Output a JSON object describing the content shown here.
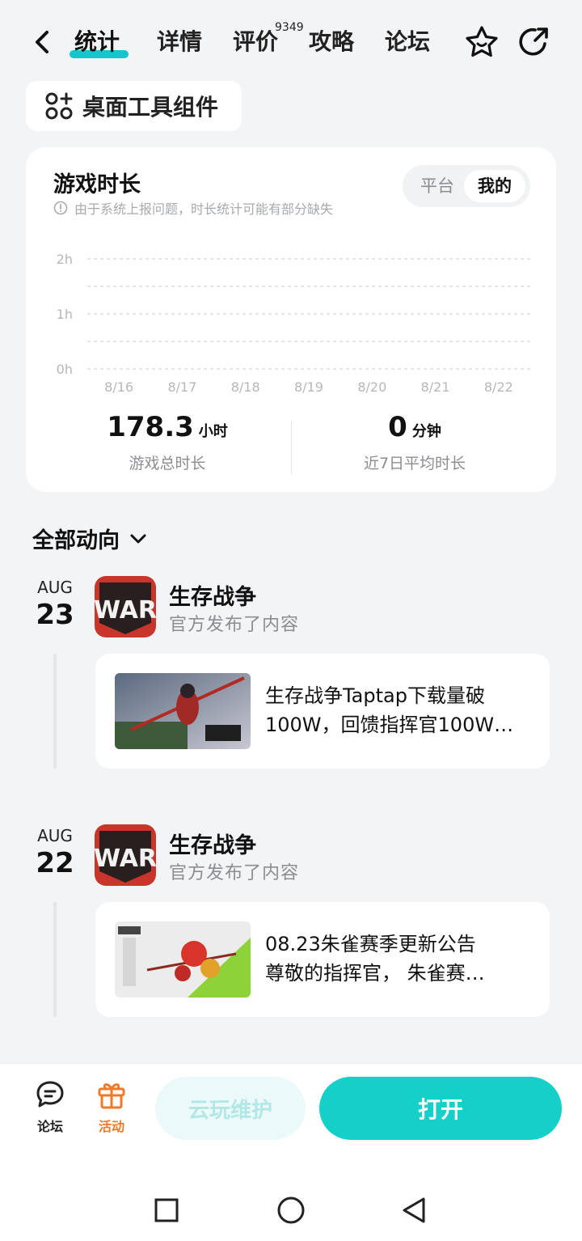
{
  "nav": {
    "tabs": [
      "统计",
      "详情",
      "评价",
      "攻略",
      "论坛"
    ],
    "review_count": "9349"
  },
  "widget": {
    "label": "桌面工具组件"
  },
  "stats_card": {
    "title": "游戏时长",
    "note": "由于系统上报问题，时长统计可能有部分缺失",
    "toggle": {
      "platform": "平台",
      "mine": "我的"
    },
    "total": {
      "value": "178.3",
      "unit": "小时",
      "label": "游戏总时长"
    },
    "average": {
      "value": "0",
      "unit": "分钟",
      "label": "近7日平均时长"
    }
  },
  "chart_data": {
    "type": "bar",
    "categories": [
      "8/16",
      "8/17",
      "8/18",
      "8/19",
      "8/20",
      "8/21",
      "8/22"
    ],
    "values": [
      0,
      0,
      0,
      0,
      0,
      0,
      0
    ],
    "y_ticks": [
      "2h",
      "1h",
      "0h"
    ],
    "ylim": [
      0,
      2
    ],
    "grid": true
  },
  "feed": {
    "header": "全部动向",
    "items": [
      {
        "month": "AUG",
        "day": "23",
        "app_name": "生存战争",
        "subtitle": "官方发布了内容",
        "line1": "生存战争Taptap下载量破",
        "line2": "100W，回馈指挥官100W…"
      },
      {
        "month": "AUG",
        "day": "22",
        "app_name": "生存战争",
        "subtitle": "官方发布了内容",
        "line1": "08.23朱雀赛季更新公告",
        "line2": "尊敬的指挥官， 朱雀赛…"
      }
    ]
  },
  "bottom": {
    "forum_label": "论坛",
    "events_label": "活动",
    "cloud_label": "云玩维护",
    "open_label": "打开",
    "accent": "#15d0c8",
    "events_color": "#f07a2a"
  }
}
